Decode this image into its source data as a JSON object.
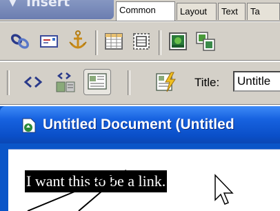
{
  "insert_panel": {
    "title": "Insert",
    "tabs": [
      {
        "label": "Common",
        "active": true
      },
      {
        "label": "Layout",
        "active": false
      },
      {
        "label": "Text",
        "active": false
      },
      {
        "label": "Ta",
        "active": false
      }
    ],
    "buttons": [
      {
        "icon": "hyperlink-icon"
      },
      {
        "icon": "email-link-icon"
      },
      {
        "icon": "named-anchor-icon"
      },
      {
        "icon": "table-icon"
      },
      {
        "icon": "layer-icon"
      },
      {
        "icon": "image-icon"
      },
      {
        "icon": "image-placeholder-icon"
      }
    ]
  },
  "document_toolbar": {
    "buttons": [
      {
        "icon": "code-view-icon"
      },
      {
        "icon": "split-view-icon"
      },
      {
        "icon": "design-view-icon"
      },
      {
        "icon": "live-data-icon"
      }
    ],
    "title_label": "Title:",
    "title_value": "Untitle"
  },
  "document_window": {
    "icon": "dreamweaver-document-icon",
    "title": "Untitled Document (Untitled",
    "selected_text": "I want this to be a link."
  },
  "colors": {
    "panel_bg": "#d4d0c8",
    "titlebar_blue": "#1762e0",
    "selection_bg": "#000000"
  }
}
